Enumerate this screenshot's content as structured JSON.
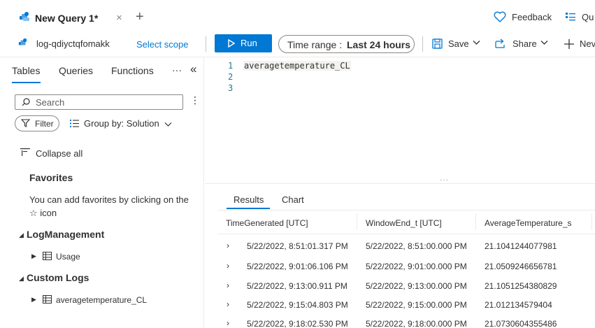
{
  "tab": {
    "title": "New Query 1*",
    "close": "×",
    "add": "+"
  },
  "header_actions": {
    "feedback": "Feedback",
    "queries": "Qu"
  },
  "toolbar": {
    "workspace": "log-qdiyctqfomakk",
    "select_scope": "Select scope",
    "run": "Run",
    "time_range_label": "Time range :",
    "time_range_value": "Last 24 hours",
    "save": "Save",
    "share": "Share",
    "new": "Nev"
  },
  "left_pane": {
    "tabs": [
      "Tables",
      "Queries",
      "Functions"
    ],
    "more": "···",
    "collapse_pane": "«",
    "search_placeholder": "Search",
    "filter": "Filter",
    "group_by": "Group by: Solution",
    "collapse_all": "Collapse all",
    "favorites_heading": "Favorites",
    "favorites_text": "You can add favorites by clicking on the ☆ icon",
    "groups": [
      {
        "name": "LogManagement",
        "tables": [
          "Usage"
        ]
      },
      {
        "name": "Custom Logs",
        "tables": [
          "averagetemperature_CL"
        ]
      }
    ]
  },
  "editor": {
    "line_numbers": [
      "1",
      "2",
      "3"
    ],
    "code": "averagetemperature_CL"
  },
  "results": {
    "tabs": [
      "Results",
      "Chart"
    ],
    "columns": [
      "TimeGenerated [UTC]",
      "WindowEnd_t [UTC]",
      "AverageTemperature_s"
    ],
    "rows": [
      [
        "5/22/2022, 8:51:01.317 PM",
        "5/22/2022, 8:51:00.000 PM",
        "21.1041244077981"
      ],
      [
        "5/22/2022, 9:01:06.106 PM",
        "5/22/2022, 9:01:00.000 PM",
        "21.0509246656781"
      ],
      [
        "5/22/2022, 9:13:00.911 PM",
        "5/22/2022, 9:13:00.000 PM",
        "21.1051254380829"
      ],
      [
        "5/22/2022, 9:15:04.803 PM",
        "5/22/2022, 9:15:00.000 PM",
        "21.012134579404"
      ],
      [
        "5/22/2022, 9:18:02.530 PM",
        "5/22/2022, 9:18:00.000 PM",
        "21.0730604355486"
      ]
    ]
  },
  "colors": {
    "accent": "#0078d4",
    "text": "#323130",
    "border": "#edebe9"
  }
}
